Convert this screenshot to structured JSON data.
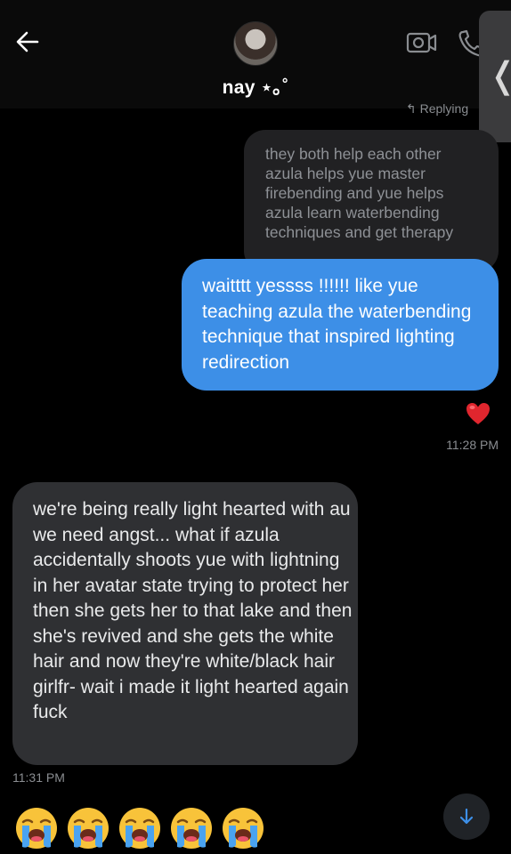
{
  "header": {
    "contact_name": "nay ⋆｡˚"
  },
  "thread": {
    "replying_label": "Replying",
    "quoted_message": "they both help each other\nazula helps yue master\nfirebending and yue helps\nazula learn waterbending\ntechniques and get therapy",
    "sent_message": "waitttt yessss !!!!!! like yue teaching azula the waterbending technique that inspired lighting redirection",
    "reaction": "❤️",
    "sent_time": "11:28 PM",
    "received_message": "we're being really light hearted with au we need angst... what if azula accidentally shoots yue with lightning in her avatar state trying to protect her then she gets her to that lake and then she's revived and she gets the white hair and now they're white/black hair girlfr- wait i made it light hearted again fuck",
    "received_time": "11:31 PM",
    "emoji_reactions": [
      "😭",
      "😭",
      "😭",
      "😭",
      "😭"
    ]
  },
  "icons": {
    "back": "arrow-left-icon",
    "video": "video-call-icon",
    "phone": "phone-icon",
    "scroll": "arrow-down-icon"
  },
  "colors": {
    "background": "#000000",
    "sent_bubble": "#3d8fe7",
    "received_bubble": "#2f3033",
    "quoted_bubble": "#212123"
  }
}
